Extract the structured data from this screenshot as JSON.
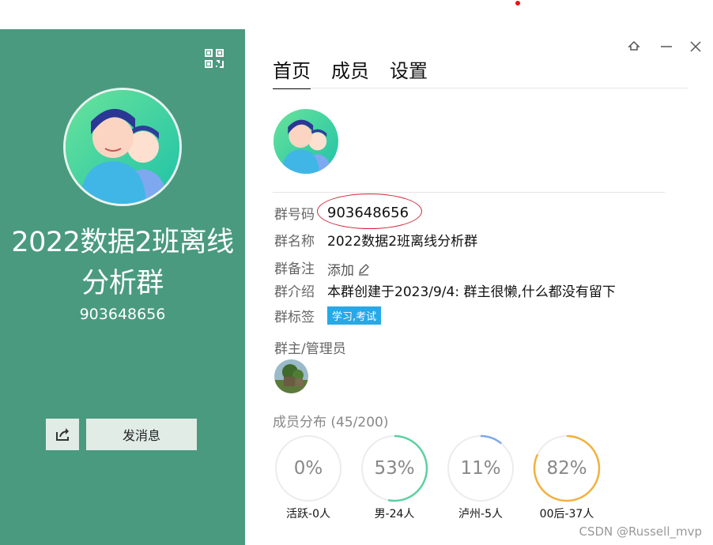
{
  "left": {
    "group_name": "2022数据2班离线分析群",
    "group_id": "903648656",
    "send_message_label": "发消息"
  },
  "tabs": [
    "首页",
    "成员",
    "设置"
  ],
  "info": {
    "number_label": "群号码",
    "number_value": "903648656",
    "name_label": "群名称",
    "name_value": "2022数据2班离线分析群",
    "remark_label": "群备注",
    "remark_value": "添加",
    "intro_label": "群介绍",
    "intro_value": "本群创建于2023/9/4:  群主很懒,什么都没有留下",
    "tag_label": "群标签",
    "tag_value": "学习,考试"
  },
  "owner_label": "群主/管理员",
  "distribution": {
    "label": "成员分布  (45/200)",
    "stats": [
      {
        "pct": "0%",
        "caption": "活跃-0人",
        "value": 0,
        "color": "#cccccc"
      },
      {
        "pct": "53%",
        "caption": "男-24人",
        "value": 0.53,
        "color": "#5cd0a0"
      },
      {
        "pct": "11%",
        "caption": "泸州-5人",
        "value": 0.11,
        "color": "#7ea8e8"
      },
      {
        "pct": "82%",
        "caption": "00后-37人",
        "value": 0.82,
        "color": "#f2b13c"
      }
    ]
  },
  "watermark": "CSDN @Russell_mvp",
  "colors": {
    "panel": "#4a9a7f",
    "tag": "#26a9e8",
    "highlight": "#cc2233"
  }
}
